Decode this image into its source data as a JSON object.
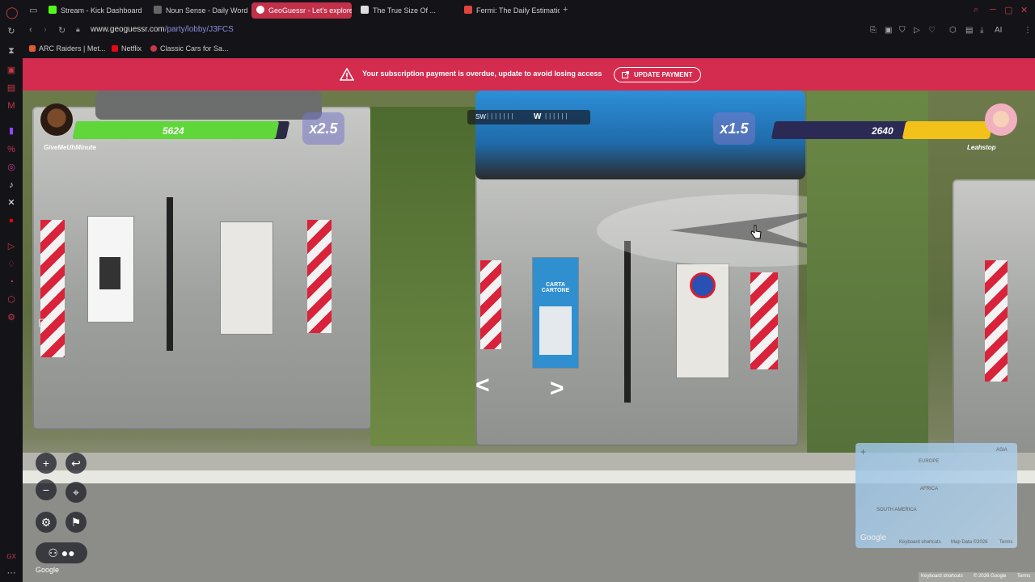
{
  "tabs": [
    {
      "label": "Stream - Kick Dashboard",
      "color": "#53fc18"
    },
    {
      "label": "Noun Sense - Daily Word",
      "color": "#666666"
    },
    {
      "label": "GeoGuessr - Let's explore",
      "color": "#ffffff"
    },
    {
      "label": "The True Size Of ...",
      "color": "#dddddd"
    },
    {
      "label": "Fermi: The Daily Estimation",
      "color": "#e0443c"
    }
  ],
  "address": {
    "host": "www.geoguessr.com",
    "path": "/party/lobby/J3FCS"
  },
  "bookmarks": [
    {
      "label": "ARC Raiders | Met...",
      "color": "#e05c2c"
    },
    {
      "label": "Netflix",
      "color": "#e50914"
    },
    {
      "label": "Classic Cars for Sa...",
      "color": "#c63a4a"
    }
  ],
  "banner": {
    "message": "Your subscription payment is overdue, update to avoid losing access",
    "button": "UPDATE PAYMENT",
    "color": "#d42c4f"
  },
  "players": {
    "left": {
      "name": "GiveMeUhMinute",
      "score": "5624",
      "multiplier": "x2.5",
      "bar_color": "#5fd63a",
      "score_fraction": 0.95
    },
    "right": {
      "name": "Leahstop",
      "score": "2640",
      "multiplier": "x1.5",
      "bar_color": "#f2c21b",
      "score_fraction": 0.4
    }
  },
  "compass": {
    "sw": "SW",
    "w": "W"
  },
  "minimap": {
    "labels": [
      "ASIA",
      "EUROPE",
      "AFRICA",
      "SOUTH AMERICA"
    ],
    "attribution": [
      "Keyboard shortcuts",
      "Map Data ©2026",
      "Terms"
    ],
    "google": "Google"
  },
  "scene_signs": {
    "carta": "CARTA CARTONE"
  },
  "footer": {
    "google": "Google",
    "shortcuts": "Keyboard shortcuts",
    "data": "© 2026 Google",
    "terms": "Terms"
  },
  "icons": [
    "opera-logo",
    "plus-icon",
    "minus-icon",
    "undo-icon",
    "pin-icon",
    "settings-icon",
    "flag-icon",
    "players-icon",
    "chat-icon",
    "warning-icon",
    "external-link-icon"
  ]
}
